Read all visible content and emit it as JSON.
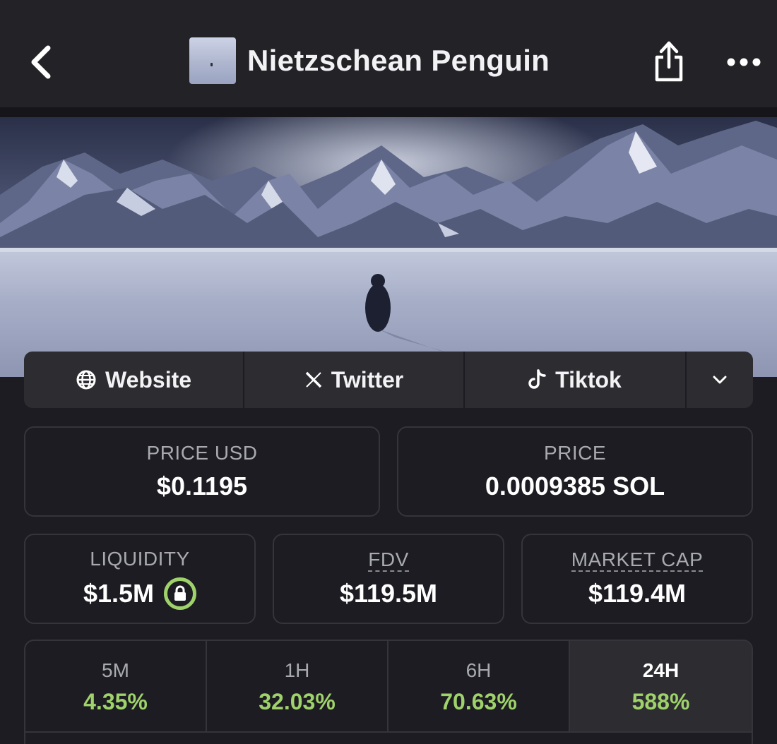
{
  "header": {
    "title": "Nietzschean Penguin",
    "back_icon": "chevron-left-icon",
    "share_icon": "share-icon",
    "more_icon": "more-horizontal-icon"
  },
  "banner": {
    "image": "mountain-landscape-with-penguin"
  },
  "socials": {
    "website_label": "Website",
    "twitter_label": "Twitter",
    "tiktok_label": "Tiktok",
    "expand_icon": "chevron-down-icon"
  },
  "stats": {
    "price_usd_label": "PRICE USD",
    "price_usd_value": "$0.1195",
    "price_label": "PRICE",
    "price_value": "0.0009385 SOL",
    "liquidity_label": "LIQUIDITY",
    "liquidity_value": "$1.5M",
    "fdv_label": "FDV",
    "fdv_value": "$119.5M",
    "mcap_label": "MARKET CAP",
    "mcap_value": "$119.4M"
  },
  "changes": [
    {
      "label": "5M",
      "value": "4.35%"
    },
    {
      "label": "1H",
      "value": "32.03%"
    },
    {
      "label": "6H",
      "value": "70.63%"
    },
    {
      "label": "24H",
      "value": "588%"
    }
  ],
  "colors": {
    "background": "#1c1c22",
    "header": "#232327",
    "card_border": "#34343a",
    "positive": "#9fd26a",
    "muted_text": "#a9a9b0"
  }
}
